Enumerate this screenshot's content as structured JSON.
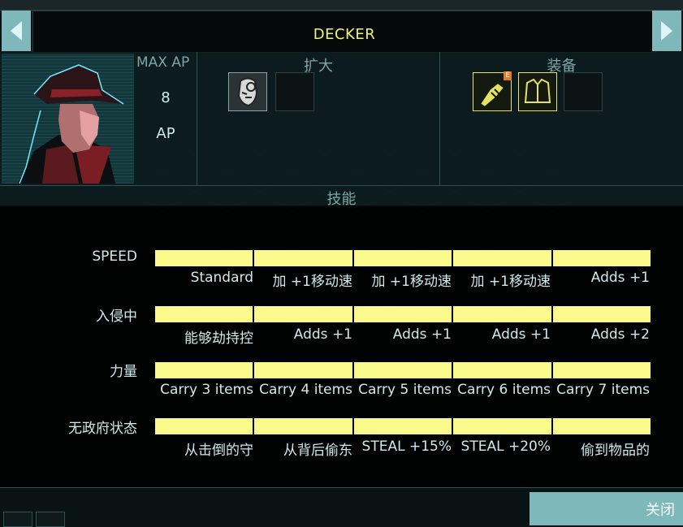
{
  "header": {
    "title": "DECKER"
  },
  "navigation": {
    "prev_icon": "chevron-left-icon",
    "next_icon": "chevron-right-icon"
  },
  "stats": {
    "max_ap_label": "MAX AP",
    "ap_value": "8",
    "ap_unit": "AP"
  },
  "augments": {
    "heading": "扩大",
    "slots": [
      {
        "icon": "cyber-face-augment-icon",
        "filled": true
      },
      {
        "icon": "",
        "filled": false
      }
    ]
  },
  "equipment": {
    "heading": "装备",
    "badge": "E",
    "slots": [
      {
        "icon": "taser-gun-icon",
        "filled": true,
        "badge": "E"
      },
      {
        "icon": "armor-vest-icon",
        "filled": true
      },
      {
        "icon": "",
        "filled": false
      }
    ]
  },
  "skills": {
    "heading": "技能",
    "rows": [
      {
        "name": "SPEED",
        "levels": [
          "Standard",
          "加 +1移动速",
          "加 +1移动速",
          "加 +1移动速",
          "Adds +1"
        ]
      },
      {
        "name": "入侵中",
        "levels": [
          "能够劫持控",
          "Adds +1",
          "Adds +1",
          "Adds +1",
          "Adds +2"
        ]
      },
      {
        "name": "力量",
        "levels": [
          "Carry 3 items",
          "Carry 4 items",
          "Carry 5 items",
          "Carry 6 items",
          "Carry 7 items"
        ]
      },
      {
        "name": "无政府状态",
        "levels": [
          "从击倒的守",
          "从背后偷东",
          "STEAL +15%",
          "STEAL +20%",
          "偷到物品的"
        ]
      }
    ]
  },
  "footer": {
    "close_label": "关闭"
  },
  "colors": {
    "accent": "#fafa8c",
    "title": "#f2f27a",
    "panel_button": "#7fb8bb",
    "equip_highlight": "#e8e060"
  }
}
